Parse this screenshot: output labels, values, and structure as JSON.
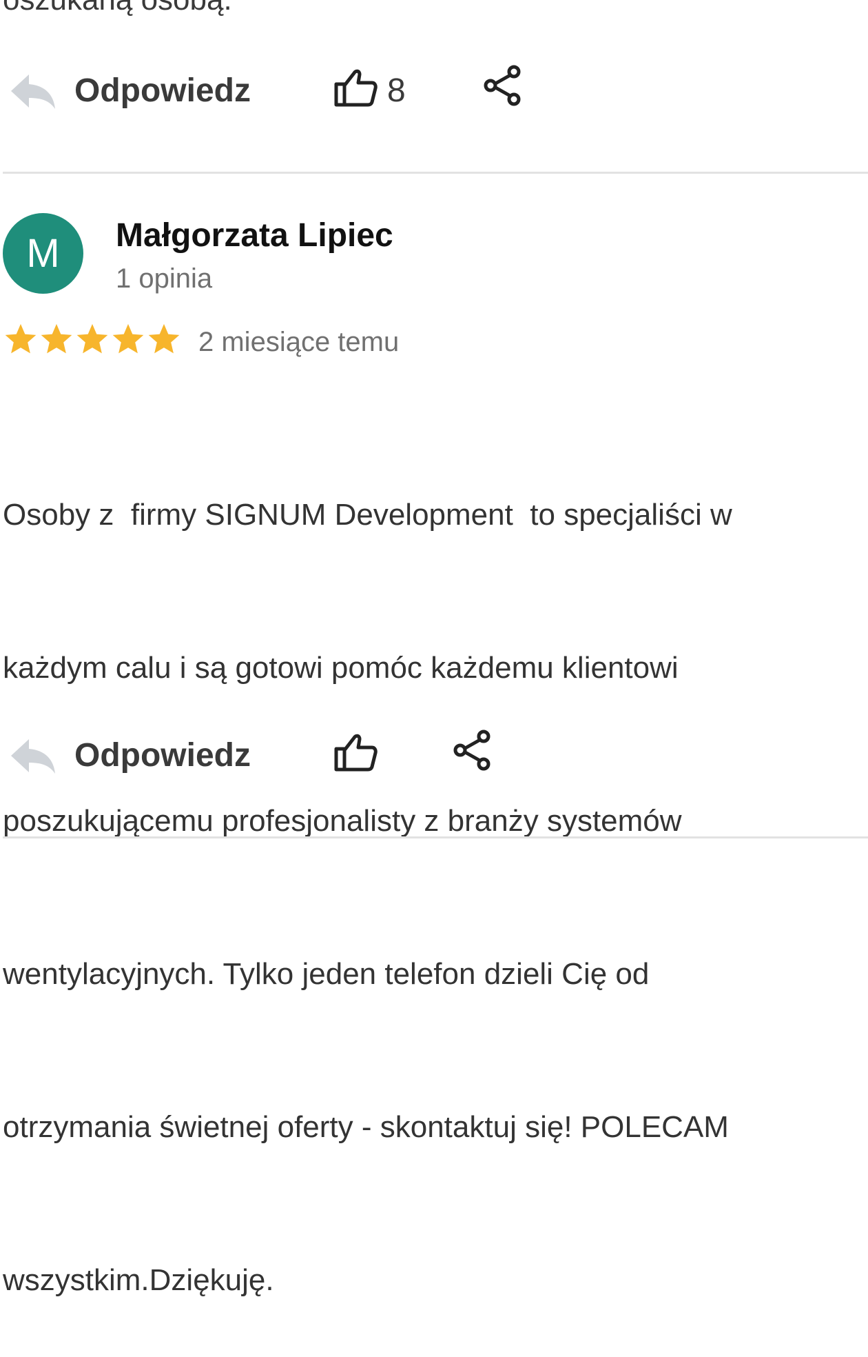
{
  "previous_review": {
    "text_tail": "oszukaną osobą.",
    "actions": {
      "reply_label": "Odpowiedz",
      "like_count": "8",
      "icons": [
        "reply-arrow-icon",
        "thumbs-up-icon",
        "share-icon"
      ]
    }
  },
  "review": {
    "avatar_letter": "M",
    "avatar_color": "#1f8e7b",
    "author_name": "Małgorzata Lipiec",
    "author_meta": "1 opinia",
    "rating": 5,
    "rating_max": 5,
    "star_color": "#f7b52c",
    "date": "2 miesiące temu",
    "text_lines": [
      "Osoby z  firmy SIGNUM Development  to specjaliści w",
      "każdym calu i są gotowi pomóc każdemu klientowi",
      "poszukującemu profesjonalisty z branży systemów",
      "wentylacyjnych. Tylko jeden telefon dzieli Cię od",
      "otrzymania świetnej oferty - skontaktuj się! POLECAM",
      "wszystkim.Dziękuję."
    ],
    "actions": {
      "reply_label": "Odpowiedz",
      "icons": [
        "reply-arrow-icon",
        "thumbs-up-icon",
        "share-icon"
      ]
    }
  },
  "colors": {
    "reply_icon": "#cfd3d8",
    "icon_dark": "#222222",
    "divider": "#e2e2e2"
  }
}
